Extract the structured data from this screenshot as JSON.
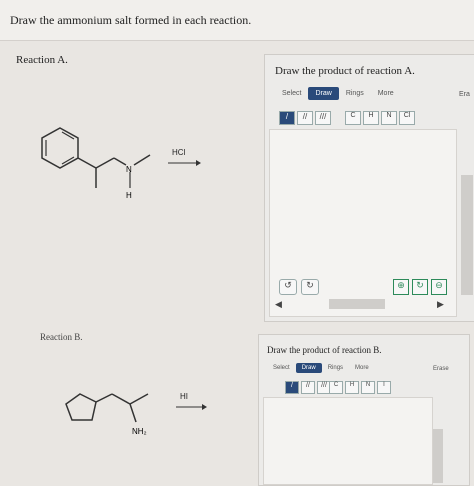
{
  "question": "Draw the ammonium salt formed in each reaction.",
  "reaction_a": {
    "label": "Reaction A.",
    "reagent": "HCl",
    "atoms": {
      "n": "N",
      "h": "H"
    },
    "panel_title": "Draw the product of reaction A.",
    "tabs": [
      "Select",
      "Draw",
      "Rings",
      "More"
    ],
    "erase": "Era",
    "atom_buttons": [
      "C",
      "H",
      "N",
      "Cl"
    ],
    "bond_buttons": [
      "/",
      "//",
      "///"
    ]
  },
  "reaction_b": {
    "label": "Reaction B.",
    "reagent": "HI",
    "amine": "NH₂",
    "panel_title": "Draw the product of reaction B.",
    "tabs": [
      "Select",
      "Draw",
      "Rings",
      "More"
    ],
    "erase": "Erase",
    "atom_buttons": [
      "C",
      "H",
      "N",
      "I"
    ],
    "bond_buttons": [
      "/",
      "//",
      "///"
    ]
  },
  "colors": {
    "accent": "#2a4a7a",
    "zoom": "#2d8a5a"
  }
}
